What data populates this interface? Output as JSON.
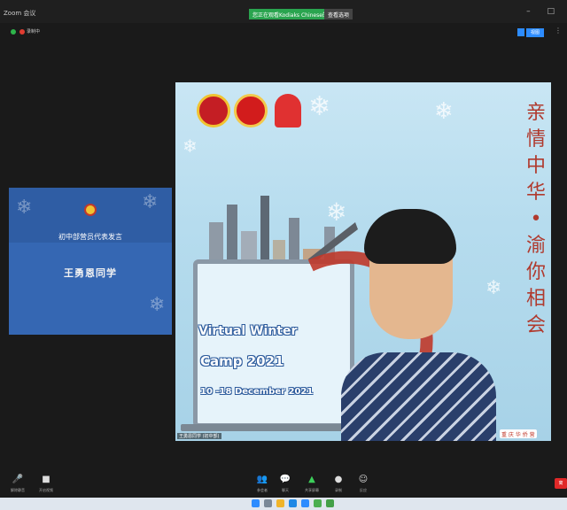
{
  "window": {
    "app_name": "Zoom 会议",
    "share_banner": "您正在观看Kodiaks Chinese的屏幕",
    "view_options": "查看选项",
    "controls": "–  □"
  },
  "topbar": {
    "recording_label": "录制中",
    "view_button": "视图"
  },
  "participant_tile": {
    "subtitle": "初中部营员代表发言",
    "name": "王勇恩同学"
  },
  "shared_screen": {
    "title_line1": "Virtual Winter",
    "title_line2": "Camp 2021",
    "date_line": "10 -18 December 2021",
    "vertical_text": [
      "亲",
      "情",
      "中",
      "华",
      "•",
      "渝",
      "你",
      "相",
      "会"
    ],
    "speaker_label": "王勇恩同学 (初中部)",
    "brand_label": "重 庆 华 侨 营"
  },
  "toolbar": {
    "items": [
      {
        "icon": "microphone-icon",
        "glyph": "🎤",
        "label": "解除静音"
      },
      {
        "icon": "video-icon",
        "glyph": "■",
        "label": "开启视频"
      },
      {
        "icon": "participants-icon",
        "glyph": "👥",
        "label": "参会者"
      },
      {
        "icon": "chat-icon",
        "glyph": "💬",
        "label": "聊天"
      },
      {
        "icon": "share-screen-icon",
        "glyph": "▲",
        "label": "共享屏幕"
      },
      {
        "icon": "record-icon",
        "glyph": "●",
        "label": "录制"
      },
      {
        "icon": "reactions-icon",
        "glyph": "☺",
        "label": "反应"
      }
    ],
    "end_label": "离"
  },
  "colors": {
    "tile_blue": "#3567b3",
    "share_green": "#2aa44f",
    "end_red": "#e02828",
    "accent_blue": "#2d8cff"
  }
}
